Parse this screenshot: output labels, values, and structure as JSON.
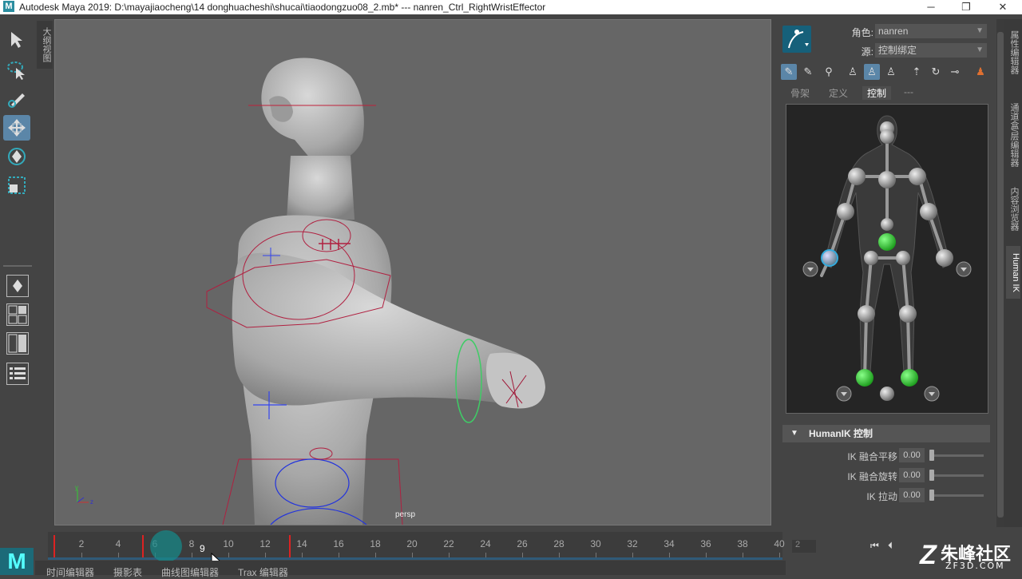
{
  "titlebar": {
    "logo": "M",
    "title": "Autodesk Maya 2019: D:\\mayajiaocheng\\14 donghuacheshi\\shucai\\tiaodongzuo08_2.mb*   ---   nanren_Ctrl_RightWristEffector",
    "minimize": "─",
    "restore": "❐",
    "close": "✕"
  },
  "toolbox": {
    "outliner_tab": "大纲视图"
  },
  "viewport": {
    "camera_label": "persp",
    "axis_x": "x",
    "axis_y": "y",
    "axis_z": "z"
  },
  "timeline": {
    "ticks": [
      "2",
      "4",
      "6",
      "8",
      "10",
      "12",
      "14",
      "16",
      "18",
      "20",
      "22",
      "24",
      "26",
      "28",
      "30",
      "32",
      "34",
      "36",
      "38",
      "40"
    ],
    "current_frame": "9",
    "keys": [
      1,
      6,
      14
    ],
    "frame_field": "2"
  },
  "bottom_tabs": [
    "时间编辑器",
    "摄影表",
    "曲线图编辑器",
    "Trax 编辑器"
  ],
  "hik_panel": {
    "character_label": "角色:",
    "character_value": "nanren",
    "source_label": "源:",
    "source_value": "控制绑定",
    "tabs": [
      "骨架",
      "定义",
      "控制",
      "---"
    ],
    "selected_tab": "控制",
    "section_title": "HumanIK 控制",
    "sliders": [
      {
        "label": "IK 融合平移",
        "value": "0.00"
      },
      {
        "label": "IK 融合旋转",
        "value": "0.00"
      },
      {
        "label": "IK 拉动",
        "value": "0.00"
      }
    ]
  },
  "side_tabs": [
    "属性编辑器",
    "通道盒/层编辑器",
    "内容浏览器",
    "Human IK"
  ],
  "selected_side_tab": "Human IK",
  "watermark": {
    "main": "朱峰社区",
    "sub": "ZF3D.COM"
  },
  "colors": {
    "accent": "#5b86a8",
    "selected_joint": "#22cc22",
    "key_marker": "#dd2222"
  }
}
